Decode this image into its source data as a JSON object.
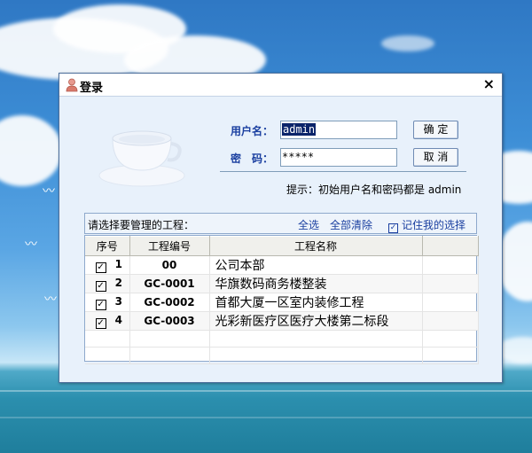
{
  "window": {
    "title": "登录",
    "close_glyph": "×"
  },
  "login": {
    "username_label": "用户名：",
    "username_value": "admin",
    "password_label": "密　码：",
    "password_value": "*****",
    "ok_label": "确 定",
    "cancel_label": "取 消",
    "hint": "提示：初始用户名和密码都是 admin"
  },
  "projects": {
    "prompt": "请选择要管理的工程：",
    "select_all": "全选",
    "clear_all": "全部清除",
    "remember_label": "记住我的选择",
    "remember_checked": true,
    "columns": [
      "序号",
      "工程编号",
      "工程名称",
      ""
    ],
    "rows": [
      {
        "checked": true,
        "index": "1",
        "code": "00",
        "name": "公司本部"
      },
      {
        "checked": true,
        "index": "2",
        "code": "GC-0001",
        "name": "华旗数码商务楼整装"
      },
      {
        "checked": true,
        "index": "3",
        "code": "GC-0002",
        "name": "首都大厦一区室内装修工程"
      },
      {
        "checked": true,
        "index": "4",
        "code": "GC-0003",
        "name": "光彩新医疗区医疗大楼第二标段"
      }
    ]
  },
  "icons": {
    "title": "user-icon",
    "close": "close-icon",
    "decoration": "coffee-cup-icon",
    "checkbox": "checkbox-checked-icon"
  },
  "colors": {
    "label_blue": "#1a3fa0",
    "selection": "#0a246a",
    "window_bg": "#e8f1fb"
  }
}
